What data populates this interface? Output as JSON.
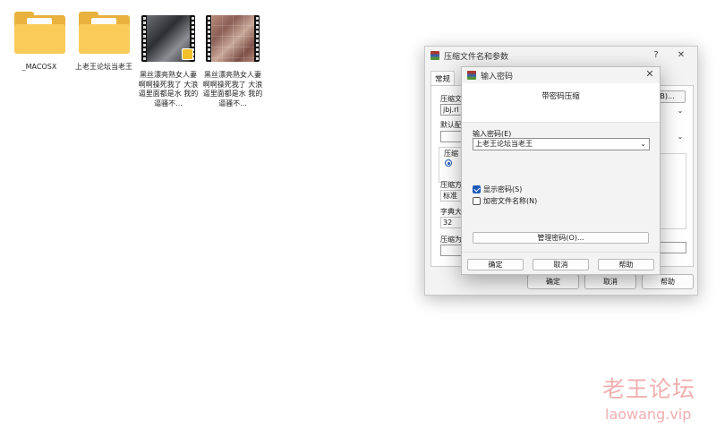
{
  "desktop": {
    "files": [
      {
        "name": "_MACOSX",
        "type": "folder"
      },
      {
        "name": "上老王论坛当老王",
        "type": "folder"
      },
      {
        "name": "黑丝漂亮熟女人妻 啊啊操死我了 大浪逼里面都是水 我的逼骚不...",
        "type": "video"
      },
      {
        "name": "黑丝漂亮熟女人妻 啊啊操死我了 大浪逼里面都是水 我的逼骚不...",
        "type": "video"
      }
    ]
  },
  "archive_dialog": {
    "title": "压缩文件名和参数",
    "help_glyph": "?",
    "close_glyph": "✕",
    "tab_general": "常规",
    "label_archive_name": "压缩文",
    "archive_name_value": "jbj.rl",
    "browse_label": "(B)...",
    "label_default_profile": "默认配",
    "group_format_label": "压缩",
    "label_method": "压缩方",
    "method_value": "标准",
    "label_dictionary": "字典大",
    "dictionary_value": "32",
    "label_split": "压缩为",
    "ok_label": "确定",
    "cancel_label": "取消",
    "help_label": "帮助"
  },
  "password_dialog": {
    "title": "输入密码",
    "close_glyph": "✕",
    "header_text": "带密码压缩",
    "password_label": "输入密码(E)",
    "password_value": "上老王论坛当老王",
    "show_password_label": "显示密码(S)",
    "show_password_checked": true,
    "encrypt_names_label": "加密文件名称(N)",
    "encrypt_names_checked": false,
    "manage_label": "管理密码(O)...",
    "ok_label": "确定",
    "cancel_label": "取消",
    "help_label": "帮助"
  },
  "watermark": {
    "title": "老王论坛",
    "url": "laowang.vip"
  },
  "colors": {
    "folder_back": "#e9b13d",
    "folder_front": "#fbcb59",
    "accent": "#1c5bb8",
    "watermark": "#e46e6e"
  }
}
